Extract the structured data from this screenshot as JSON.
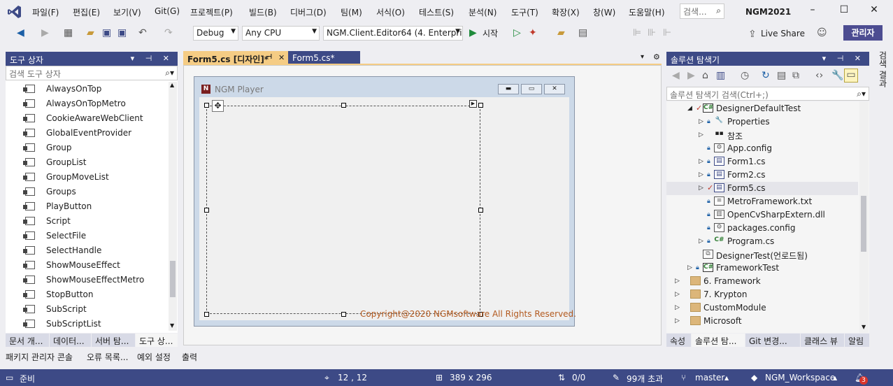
{
  "menu": [
    "파일(F)",
    "편집(E)",
    "보기(V)",
    "Git(G)",
    "프로젝트(P)",
    "빌드(B)",
    "디버그(D)",
    "팀(M)",
    "서식(O)",
    "테스트(S)",
    "분석(N)",
    "도구(T)",
    "확장(X)",
    "창(W)",
    "도움말(H)"
  ],
  "search": {
    "label": "검색..."
  },
  "solution_name": "NGM2021",
  "toolbar": {
    "config": "Debug",
    "platform": "Any CPU",
    "startup": "NGM.Client.Editor64 (4. Enterprise",
    "start_label": "시작",
    "live_share": "Live Share",
    "admin": "관리자"
  },
  "toolbox": {
    "title": "도구 상자",
    "search_placeholder": "검색 도구 상자",
    "items": [
      "AlwaysOnTop",
      "AlwaysOnTopMetro",
      "CookieAwareWebClient",
      "GlobalEventProvider",
      "Group",
      "GroupList",
      "GroupMoveList",
      "Groups",
      "PlayButton",
      "Script",
      "SelectFile",
      "SelectHandle",
      "ShowMouseEffect",
      "ShowMouseEffectMetro",
      "StopButton",
      "SubScript",
      "SubScriptList"
    ],
    "tabs": [
      "문서 개...",
      "데이터...",
      "서버 탐...",
      "도구 상..."
    ]
  },
  "editor": {
    "tabs": [
      "Form5.cs [디자인]*",
      "Form5.cs*"
    ],
    "form_title": "NGM Player",
    "copyright": "Copyright@2020 NGMsoftware All Rights Reserved."
  },
  "solution": {
    "title": "솔루션 탐색기",
    "search_placeholder": "솔루션 탐색기 검색(Ctrl+;)",
    "items": [
      {
        "label": "DesignerDefaultTest",
        "icon": "cs"
      },
      {
        "label": "Properties",
        "icon": "wrench"
      },
      {
        "label": "참조",
        "icon": "ref"
      },
      {
        "label": "App.config",
        "icon": "config"
      },
      {
        "label": "Form1.cs",
        "icon": "form"
      },
      {
        "label": "Form2.cs",
        "icon": "form"
      },
      {
        "label": "Form5.cs",
        "icon": "form"
      },
      {
        "label": "MetroFramework.txt",
        "icon": "doc"
      },
      {
        "label": "OpenCvSharpExtern.dll",
        "icon": "dll"
      },
      {
        "label": "packages.config",
        "icon": "config"
      },
      {
        "label": "Program.cs",
        "icon": "csfile"
      },
      {
        "label": "DesignerTest(언로드됨)",
        "icon": "proj"
      },
      {
        "label": "FrameworkTest",
        "icon": "cs"
      },
      {
        "label": "6. Framework",
        "icon": "folder"
      },
      {
        "label": "7. Krypton",
        "icon": "folder"
      },
      {
        "label": "CustomModule",
        "icon": "folder"
      },
      {
        "label": "Microsoft",
        "icon": "folder"
      }
    ],
    "tabs": [
      "속성",
      "솔루션 탐...",
      "Git 변경...",
      "클래스 뷰",
      "알림"
    ]
  },
  "right_vertical_tab": "검색 결과",
  "output_tabs": [
    "패키지 관리자 콘솔",
    "오류 목록...",
    "예외 설정",
    "출력"
  ],
  "status": {
    "ready": "준비",
    "position": "12 , 12",
    "size": "389 x 296",
    "changes": "0/0",
    "pending": "99개 초과",
    "branch": "master",
    "workspace": "NGM_Workspace",
    "notifications": "3"
  }
}
